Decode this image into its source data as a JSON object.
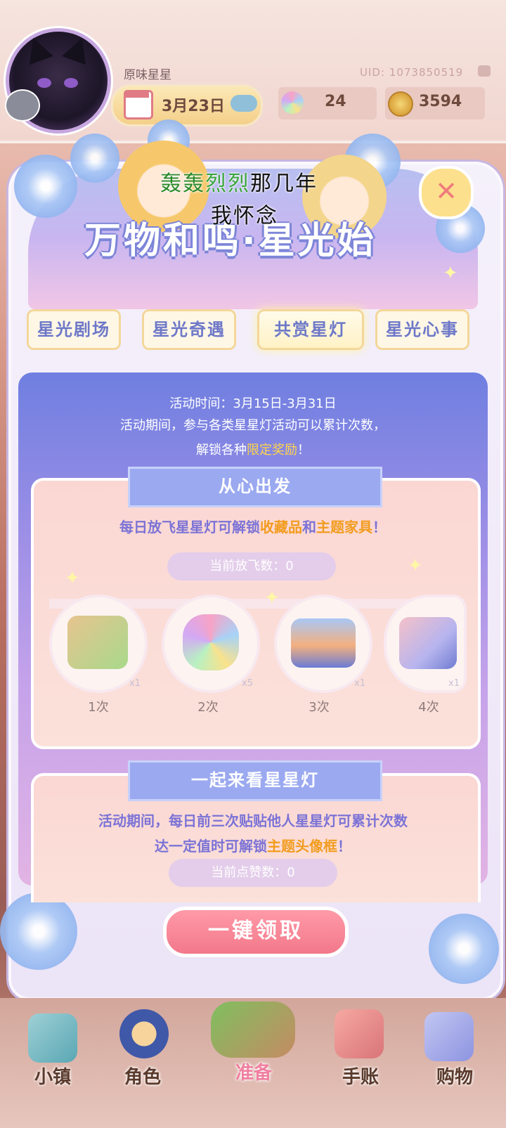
{
  "header": {
    "nickname": "原味星星",
    "uid": "UID: 1073850519",
    "date": "3月23日",
    "gems": "24",
    "coins": "3594"
  },
  "event": {
    "title": "万物和鸣·星光始",
    "overlay_line1_a": "轰轰",
    "overlay_line1_b": "烈烈",
    "overlay_line1_c": "那几年",
    "overlay_line2": "我怀念",
    "close_symbol": "✕",
    "tabs": [
      {
        "label": "星光剧场",
        "active": false
      },
      {
        "label": "星光奇遇",
        "active": false
      },
      {
        "label": "共赏星灯",
        "active": true
      },
      {
        "label": "星光心事",
        "active": false
      }
    ],
    "info_time": "活动时间：3月15日-3月31日",
    "info_line2": "活动期间，参与各类星星灯活动可以累计次数，",
    "info_line3_a": "解锁各种",
    "info_line3_hl": "限定奖励",
    "info_line3_b": "！"
  },
  "section1": {
    "title": "从心出发",
    "desc_a": "每日放飞星星灯可解锁",
    "desc_hl1": "收藏品",
    "desc_mid": "和",
    "desc_hl2": "主题家具",
    "desc_b": "！",
    "counter": "当前放飞数：0",
    "rewards": [
      {
        "qty": "x1",
        "label": "1次",
        "icon": "food-bundle-icon"
      },
      {
        "qty": "x5",
        "label": "2次",
        "icon": "rainbow-star-icon"
      },
      {
        "qty": "x1",
        "label": "3次",
        "icon": "mushroom-arch-icon"
      },
      {
        "qty": "x1",
        "label": "4次",
        "icon": "craft-supplies-icon"
      }
    ]
  },
  "section2": {
    "title": "一起来看星星灯",
    "desc_line1": "活动期间，每日前三次贴贴他人星星灯可累计次数",
    "desc_line2_a": "达一定值时可解锁",
    "desc_line2_hl": "主题头像框",
    "desc_line2_b": "！",
    "counter": "当前点赞数：0"
  },
  "claim_button": "一键领取",
  "nav": [
    {
      "label": "小镇",
      "icon": "map-icon"
    },
    {
      "label": "角色",
      "icon": "character-icon"
    },
    {
      "label": "准备",
      "icon": "picnic-basket-icon"
    },
    {
      "label": "手账",
      "icon": "journal-icon"
    },
    {
      "label": "购物",
      "icon": "shopping-bag-icon"
    }
  ],
  "colors": {
    "accent_blue": "#7d85d8",
    "highlight_orange": "#f29c1e",
    "highlight_yellow": "#ffd54a",
    "claim_pink": "#f2788a"
  }
}
